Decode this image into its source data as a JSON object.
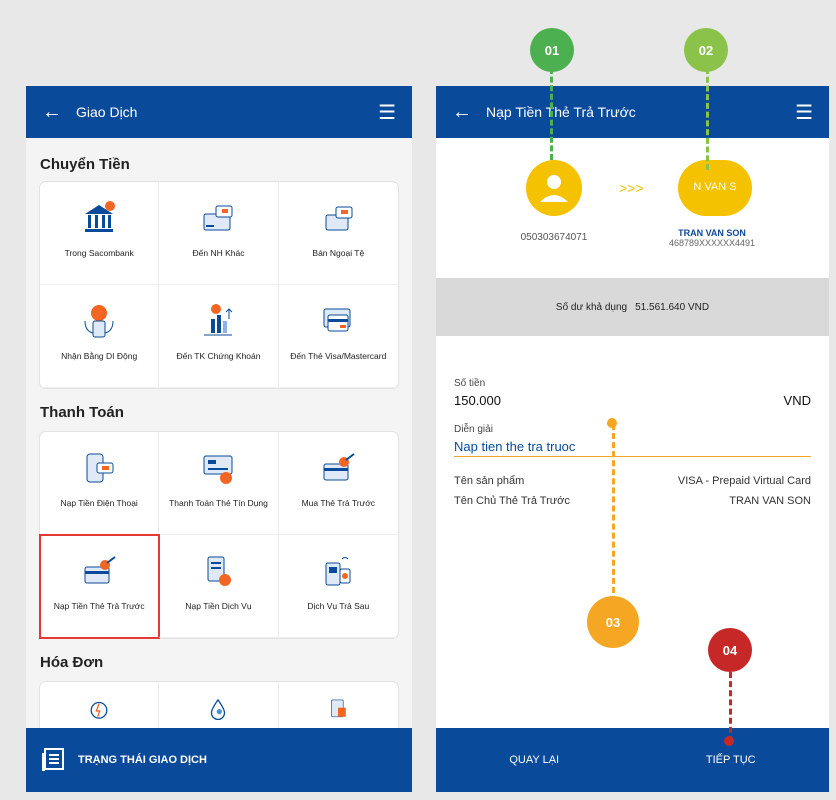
{
  "left": {
    "header": {
      "title": "Giao Dịch"
    },
    "sections": [
      {
        "title": "Chuyển Tiền",
        "items": [
          "Trong Sacombank",
          "Đến NH Khác",
          "Bán Ngoại Tệ",
          "Nhận Bằng DI Động",
          "Đến TK Chứng Khoán",
          "Đến Thẻ Visa/Mastercard"
        ]
      },
      {
        "title": "Thanh Toán",
        "items": [
          "Nạp Tiền Điện Thoại",
          "Thanh Toán Thẻ Tín Dụng",
          "Mua Thẻ Trả Trước",
          "Nạp Tiền Thẻ Trả Trước",
          "Nạp Tiền Dịch Vụ",
          "Dịch Vụ Trả Sau"
        ]
      },
      {
        "title": "Hóa Đơn"
      }
    ],
    "footer": {
      "label": "TRẠNG THÁI GIAO DỊCH"
    }
  },
  "right": {
    "header": {
      "title": "Nạp Tiền Thẻ Trả Trước"
    },
    "source_account": "050303674071",
    "arrows": ">>>",
    "target_name_on_card": "N VAN S",
    "target_name": "TRAN VAN SON",
    "target_card": "468789XXXXXX4491",
    "balance_label": "Số dư khả dụng",
    "balance_value": "51.561.640 VND",
    "amount_label": "Số tiền",
    "amount_value": "150.000",
    "amount_currency": "VND",
    "desc_label": "Diễn giải",
    "desc_value": "Nap tien the tra truoc",
    "product_label": "Tên sản phẩm",
    "product_value": "VISA - Prepaid Virtual Card",
    "holder_label": "Tên Chủ Thẻ Trả Trước",
    "holder_value": "TRAN VAN SON",
    "back_button": "QUAY LẠI",
    "continue_button": "TIẾP TỤC"
  },
  "markers": [
    "01",
    "02",
    "03",
    "04"
  ],
  "colors": {
    "primary": "#0a4a9a",
    "marker1": "#4caf50",
    "marker2": "#8bc34a",
    "marker3": "#f5a623",
    "marker4": "#c62828",
    "avatar": "#f5c200"
  }
}
